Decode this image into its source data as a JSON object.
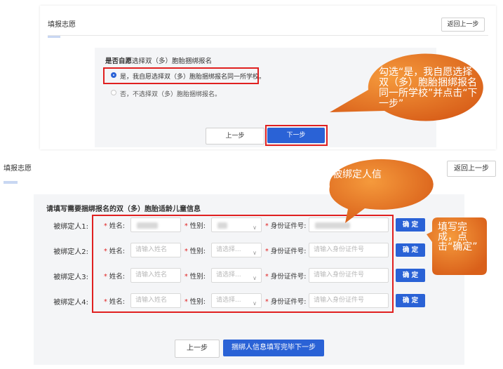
{
  "top": {
    "page_title": "填报志愿",
    "back_label": "返回上一步",
    "question_prefix": "是否自愿",
    "question_rest": "选择双（多）胞胎捆绑报名",
    "option_yes": "是，我自愿选择双（多）胞胎捆绑报名同一所学校。",
    "option_no": "否，不选择双（多）胞胎捆绑报名。",
    "prev_label": "上一步",
    "next_label": "下一步"
  },
  "bottom": {
    "page_title": "填报志愿",
    "back_label": "返回上一步",
    "form_title": "请填写需要捆绑报名的双（多）胞胎适龄儿童信息",
    "name_label": "姓名:",
    "gender_label": "性别:",
    "id_label": "身份证件号:",
    "required_mark": "*",
    "name_placeholder": "请输入姓名",
    "gender_placeholder": "请选择...",
    "id_placeholder": "请输入身份证件号",
    "confirm_label": "确 定",
    "rows": [
      {
        "label": "被绑定人1:"
      },
      {
        "label": "被绑定人2:"
      },
      {
        "label": "被绑定人3:"
      },
      {
        "label": "被绑定人4:"
      }
    ],
    "prev_label": "上一步",
    "done_label": "捆绑人信息填写完毕下一步"
  },
  "callouts": {
    "c1": "勾选“是，我自愿选择双（多）胞胎捆绑报名同一所学校”并点击“下一步”",
    "c2": "如实填写被绑定人信息",
    "c3": "填写完成，点击“确定”"
  },
  "colors": {
    "primary": "#2a62d6",
    "highlight": "#e02020",
    "callout": "#e87020"
  }
}
